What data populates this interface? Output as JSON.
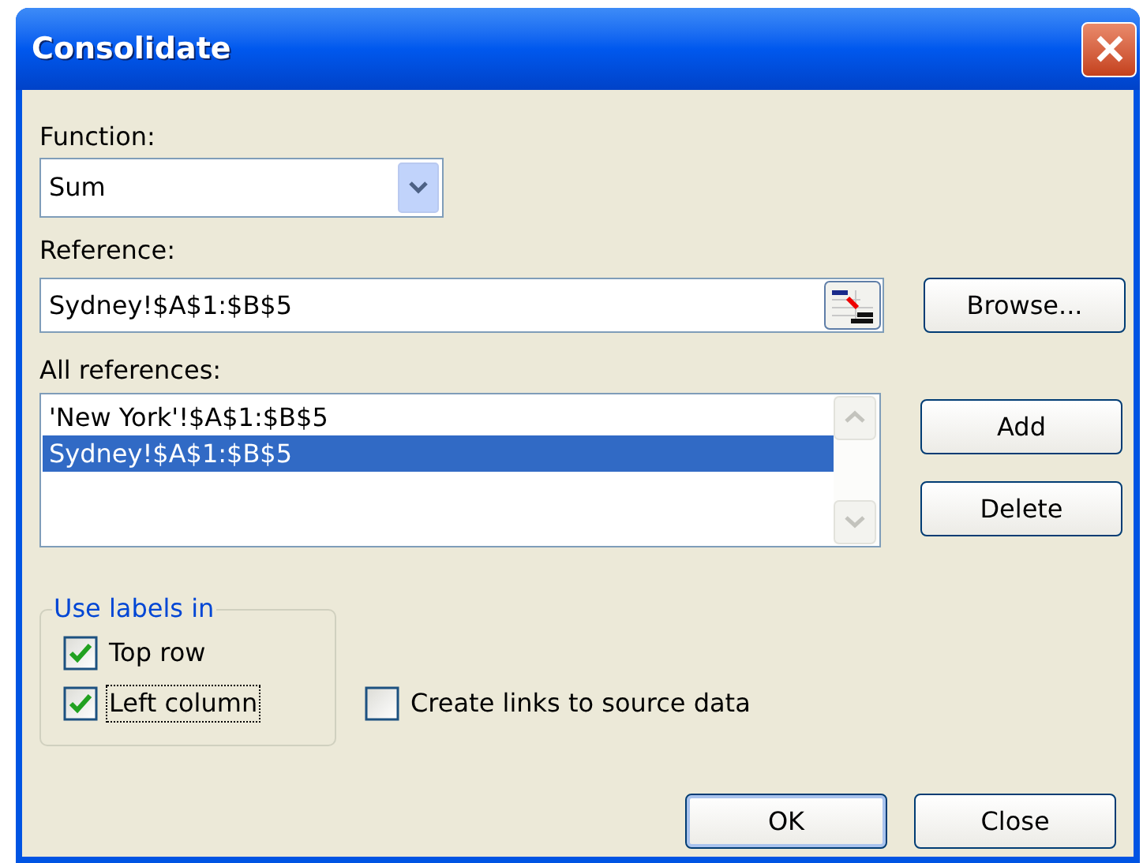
{
  "window": {
    "title": "Consolidate"
  },
  "function": {
    "label": "Function:",
    "value": "Sum"
  },
  "reference": {
    "label": "Reference:",
    "value": "Sydney!$A$1:$B$5"
  },
  "all_references": {
    "label": "All references:",
    "items": [
      {
        "text": "'New York'!$A$1:$B$5",
        "selected": false
      },
      {
        "text": "Sydney!$A$1:$B$5",
        "selected": true
      }
    ]
  },
  "side_buttons": [
    "Browse...",
    "Add",
    "Delete"
  ],
  "use_labels_in": {
    "label": "Use labels in",
    "options": [
      {
        "label": "Top row",
        "checked": true,
        "focused": false
      },
      {
        "label": "Left column",
        "checked": true,
        "focused": true
      }
    ]
  },
  "create_links": {
    "label": "Create links to source data",
    "checked": false
  },
  "buttons": [
    {
      "label": "OK",
      "default": true
    },
    {
      "label": "Close",
      "default": false
    }
  ]
}
